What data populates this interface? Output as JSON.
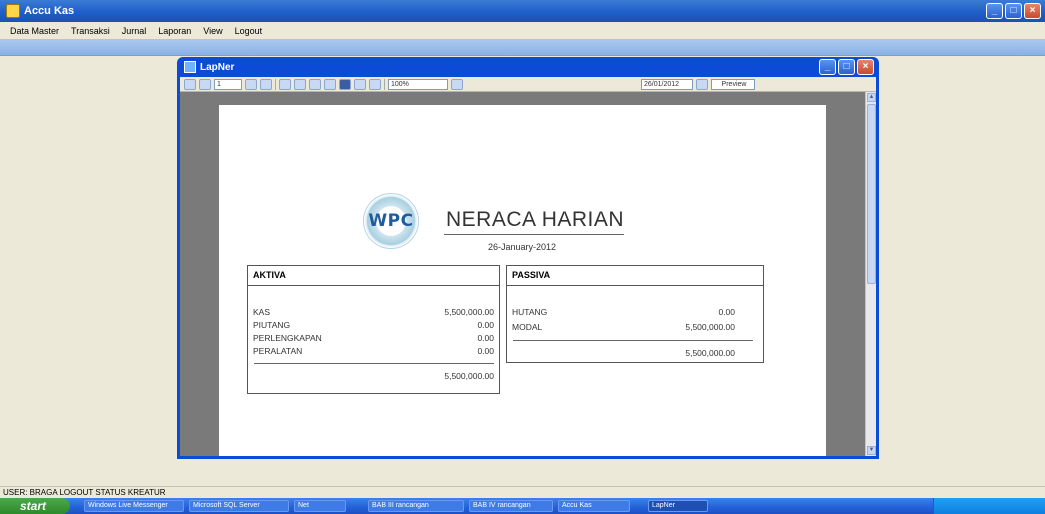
{
  "app": {
    "title": "Accu Kas"
  },
  "menu": [
    "Data Master",
    "Transaksi",
    "Jurnal",
    "Laporan",
    "View",
    "Logout"
  ],
  "window": {
    "title": "LapNer"
  },
  "toolbar": {
    "page": "1",
    "zoom": "100%",
    "date_field": "26/01/2012",
    "preview_label": "Preview"
  },
  "report": {
    "logo_text": "WPC",
    "title": "NERACA HARIAN",
    "date": "26-January-2012",
    "aktiva": {
      "header": "AKTIVA",
      "rows": [
        {
          "label": "KAS",
          "value": "5,500,000.00"
        },
        {
          "label": "PIUTANG",
          "value": "0.00"
        },
        {
          "label": "PERLENGKAPAN",
          "value": "0.00"
        },
        {
          "label": "PERALATAN",
          "value": "0.00"
        }
      ],
      "total": "5,500,000.00"
    },
    "passiva": {
      "header": "PASSIVA",
      "rows": [
        {
          "label": "HUTANG",
          "value": "0.00"
        },
        {
          "label": "MODAL",
          "value": "5,500,000.00"
        }
      ],
      "total": "5,500,000.00"
    }
  },
  "statusbar": {
    "text": "USER: BRAGA  LOGOUT  STATUS  KREATUR"
  },
  "taskbar": {
    "start_label": "start",
    "tasks": [
      "Windows Live Messenger",
      "Microsoft SQL Server",
      "Net",
      "BAB III rancangan",
      "BAB IV rancangan",
      "Accu Kas",
      "LapNer"
    ]
  }
}
